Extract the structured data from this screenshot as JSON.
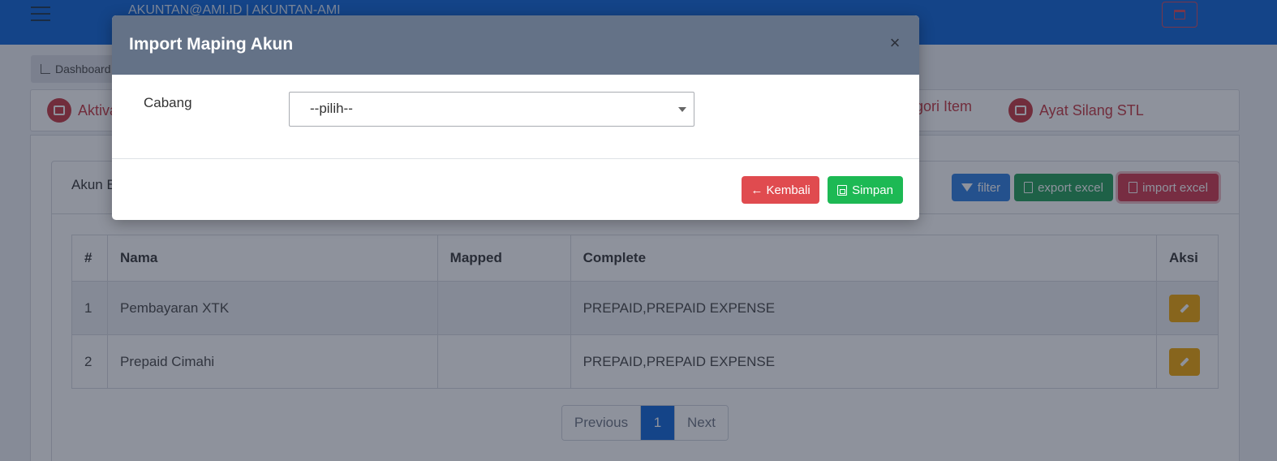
{
  "navbar": {
    "user_label": "AKUNTAN@AMI.ID | AKUNTAN-AMI"
  },
  "breadcrumb": {
    "label": "Dashboard"
  },
  "tabs": [
    {
      "label": "Aktiva"
    },
    {
      "label": "gori Item"
    },
    {
      "label": "Ayat Silang STL"
    }
  ],
  "panel": {
    "title": "Akun B",
    "filter_label": "filter",
    "export_label": "export excel",
    "import_label": "import excel"
  },
  "table": {
    "headers": {
      "no": "#",
      "nama": "Nama",
      "mapped": "Mapped",
      "complete": "Complete",
      "aksi": "Aksi"
    },
    "rows": [
      {
        "no": "1",
        "nama": "Pembayaran XTK",
        "mapped": "",
        "complete": "PREPAID,PREPAID EXPENSE"
      },
      {
        "no": "2",
        "nama": "Prepaid Cimahi",
        "mapped": "",
        "complete": "PREPAID,PREPAID EXPENSE"
      }
    ]
  },
  "pagination": {
    "previous": "Previous",
    "current": "1",
    "next": "Next"
  },
  "modal": {
    "title": "Import Maping Akun",
    "close": "×",
    "field_label": "Cabang",
    "select_value": "--pilih--",
    "back_label": "← Kembali",
    "save_label": "Simpan"
  },
  "colors": {
    "navbar": "#0b63d6",
    "modal_header": "#647287",
    "accent_red": "#c5353f",
    "kembali": "#e04b4f",
    "simpan": "#1db954",
    "edit": "#f0a500"
  }
}
